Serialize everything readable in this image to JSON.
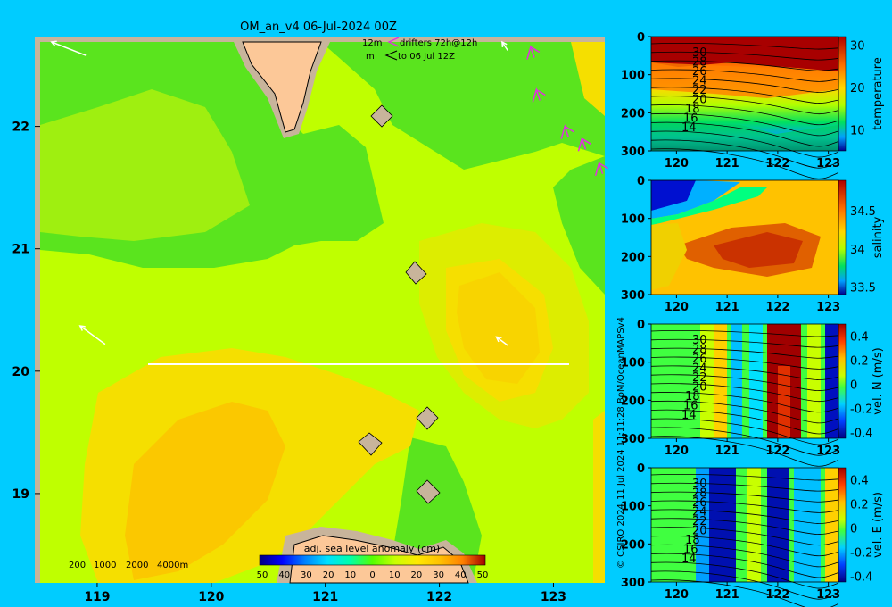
{
  "title": "OM_an_v4  06-Jul-2024 00Z",
  "credit": "11 Jul 2024 11:11:28 BoM/OceanMAPSv4",
  "copyright": "© CSIRO 2024",
  "drifters": {
    "line1_label": "12m",
    "line1_text": "drifters 72h@12h",
    "line2_label": "m",
    "line2_text": "to 06 Jul 12Z"
  },
  "depth_legend": [
    "200",
    "1000",
    "2000",
    "4000m"
  ],
  "colorbar": {
    "label": "adj. sea level anomaly (cm)",
    "ticks": [
      "50",
      "40",
      "30",
      "20",
      "10",
      "0",
      "10",
      "20",
      "30",
      "40",
      "50"
    ]
  },
  "colors": {
    "background": "#00ccff",
    "land": "#fcc898",
    "coast_shelf": "#c8b49b",
    "section_line": "#ffffff",
    "drifter_arrow": "#e030e0",
    "current_vector": "#ffffff"
  },
  "chart_data": [
    {
      "type": "heatmap",
      "name": "map",
      "x_ticks": [
        "119",
        "120",
        "121",
        "122",
        "123"
      ],
      "y_ticks": [
        "22",
        "21",
        "20",
        "19"
      ],
      "xlim": [
        118.5,
        123.45
      ],
      "ylim": [
        18.27,
        22.69
      ],
      "section_line": {
        "x": [
          119.5,
          123.2
        ],
        "y": [
          20.0,
          20.0
        ]
      },
      "current_vectors": [
        {
          "x": [
            118.9,
            118.6
          ],
          "y": [
            22.58,
            22.69
          ]
        },
        {
          "x": [
            119.07,
            118.85
          ],
          "y": [
            20.22,
            20.37
          ]
        },
        {
          "x": [
            122.6,
            122.5
          ],
          "y": [
            20.21,
            20.28
          ]
        },
        {
          "x": [
            122.6,
            122.55
          ],
          "y": [
            22.62,
            22.69
          ]
        }
      ],
      "drifter_arrows": [
        {
          "x": 122.8,
          "y": 22.65
        },
        {
          "x": 122.85,
          "y": 22.3
        },
        {
          "x": 123.1,
          "y": 22.0
        },
        {
          "x": 123.25,
          "y": 21.9
        },
        {
          "x": 123.4,
          "y": 21.7
        }
      ],
      "colorbar_range": [
        -50,
        50
      ],
      "colorbar_stops": [
        "#000080",
        "#0000ff",
        "#0080ff",
        "#00e0ff",
        "#00ffaa",
        "#55ff00",
        "#c8ff00",
        "#ffe800",
        "#ffc000",
        "#ff8000",
        "#e04000",
        "#a00000"
      ]
    },
    {
      "type": "heatmap",
      "name": "temperature",
      "y_axis_label": "temperature",
      "x_ticks": [
        "120",
        "121",
        "122",
        "123"
      ],
      "y_ticks": [
        "0",
        "100",
        "200",
        "300"
      ],
      "xlim": [
        119.5,
        123.2
      ],
      "ylim": [
        300,
        0
      ],
      "colorbar_ticks": [
        "30",
        "20",
        "10"
      ],
      "colorbar_range": [
        5,
        32
      ],
      "contour_labels": [
        "30",
        "28",
        "26",
        "24",
        "22",
        "20",
        "18",
        "16",
        "14"
      ]
    },
    {
      "type": "heatmap",
      "name": "salinity",
      "y_axis_label": "salinity",
      "x_ticks": [
        "120",
        "121",
        "122",
        "123"
      ],
      "y_ticks": [
        "0",
        "100",
        "200",
        "300"
      ],
      "xlim": [
        119.5,
        123.2
      ],
      "ylim": [
        300,
        0
      ],
      "colorbar_ticks": [
        "34.5",
        "34",
        "33.5"
      ],
      "colorbar_range": [
        33.4,
        34.9
      ]
    },
    {
      "type": "heatmap",
      "name": "vel_N",
      "y_axis_label": "vel. N (m/s)",
      "x_ticks": [
        "120",
        "121",
        "122",
        "123"
      ],
      "y_ticks": [
        "0",
        "100",
        "200",
        "300"
      ],
      "xlim": [
        119.5,
        123.2
      ],
      "ylim": [
        300,
        0
      ],
      "colorbar_ticks": [
        "0.4",
        "0.2",
        "0",
        "-0.2",
        "-0.4"
      ],
      "colorbar_range": [
        -0.45,
        0.5
      ],
      "contour_labels": [
        "30",
        "28",
        "26",
        "24",
        "22",
        "20",
        "18",
        "16",
        "14"
      ]
    },
    {
      "type": "heatmap",
      "name": "vel_E",
      "y_axis_label": "vel. E (m/s)",
      "x_ticks": [
        "120",
        "121",
        "122",
        "123"
      ],
      "y_ticks": [
        "0",
        "100",
        "200",
        "300"
      ],
      "xlim": [
        119.5,
        123.2
      ],
      "ylim": [
        300,
        0
      ],
      "colorbar_ticks": [
        "0.4",
        "0.2",
        "0",
        "-0.2",
        "-0.4"
      ],
      "colorbar_range": [
        -0.45,
        0.5
      ],
      "contour_labels": [
        "30",
        "28",
        "26",
        "24",
        "22",
        "20",
        "18",
        "16",
        "14"
      ]
    }
  ]
}
